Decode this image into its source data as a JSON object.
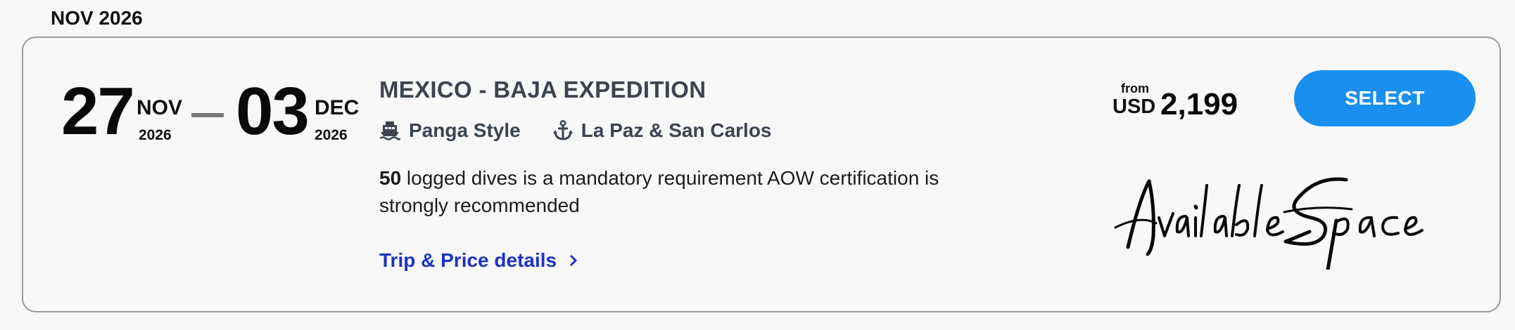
{
  "month_heading": "NOV 2026",
  "trip": {
    "start": {
      "day": "27",
      "month": "NOV",
      "year": "2026"
    },
    "end": {
      "day": "03",
      "month": "DEC",
      "year": "2026"
    },
    "title": "MEXICO - BAJA EXPEDITION",
    "style": {
      "label": "Panga Style",
      "icon": "boat-icon"
    },
    "location": {
      "label": "La Paz & San Carlos",
      "icon": "anchor-icon"
    },
    "requirement_bold": "50",
    "requirement_text": " logged dives is a mandatory requirement AOW certification is strongly recommended",
    "details_link": "Trip & Price details",
    "price": {
      "from": "from",
      "currency": "USD",
      "amount": "2,199"
    },
    "select_label": "SELECT",
    "availability": "Available Space"
  },
  "colors": {
    "accent": "#1a8ff0",
    "link": "#1c32c8",
    "title": "#3c4450"
  }
}
